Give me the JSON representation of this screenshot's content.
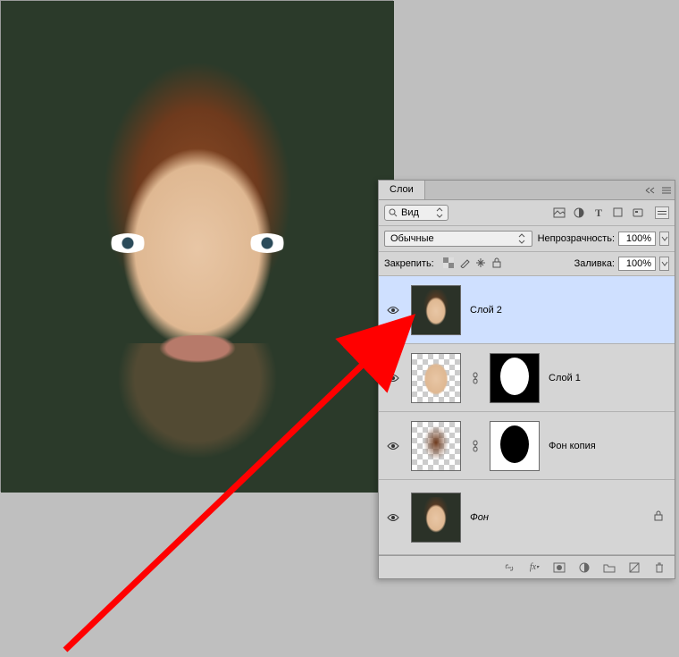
{
  "panel": {
    "tab_label": "Слои",
    "search_label": "Вид",
    "blend_mode": "Обычные",
    "opacity_label": "Непрозрачность:",
    "opacity_value": "100%",
    "lock_label": "Закрепить:",
    "fill_label": "Заливка:",
    "fill_value": "100%",
    "layers": [
      {
        "name": "Слой 2",
        "selected": true,
        "has_mask": false,
        "mask": null,
        "italic": false,
        "locked": false,
        "thumb": "full"
      },
      {
        "name": "Слой 1",
        "selected": false,
        "has_mask": true,
        "mask": "black",
        "italic": false,
        "locked": false,
        "thumb": "face"
      },
      {
        "name": "Фон копия",
        "selected": false,
        "has_mask": true,
        "mask": "white",
        "italic": false,
        "locked": false,
        "thumb": "hair"
      },
      {
        "name": "Фон",
        "selected": false,
        "has_mask": false,
        "mask": null,
        "italic": true,
        "locked": true,
        "thumb": "full"
      }
    ],
    "filter_icons": [
      "image-filter-icon",
      "adjustment-filter-icon",
      "type-filter-icon",
      "shape-filter-icon",
      "smart-filter-icon"
    ],
    "footer_icons": [
      "link-icon",
      "fx-icon",
      "mask-icon",
      "adjust-icon",
      "group-icon",
      "new-icon",
      "trash-icon"
    ]
  }
}
